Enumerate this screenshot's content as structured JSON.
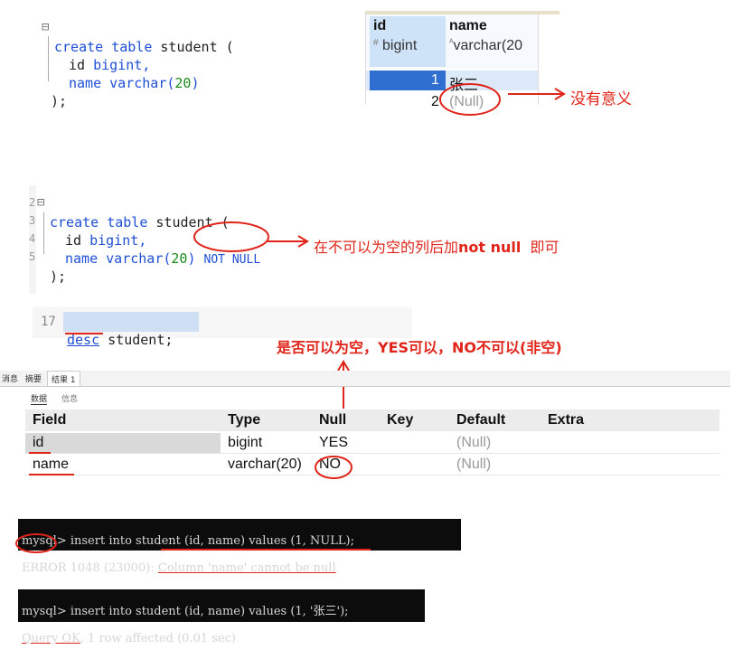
{
  "code1": {
    "line1_kw": "create table",
    "line1_rest": " student (",
    "line2_col": "id",
    "line2_type": "bigint,",
    "line3_col": "name",
    "line3_type": "varchar(",
    "line3_num": "20",
    "line3_end": ")",
    "line4": ");"
  },
  "grid1": {
    "col_id": "id",
    "col_id_type": "bigint",
    "col_name": "name",
    "col_name_type": "varchar(20",
    "row1_id": "1",
    "row1_name": "张三",
    "row2_id": "2",
    "row2_name": "(Null)",
    "annotation": "没有意义"
  },
  "code2": {
    "gutter1": "2",
    "gutter2": "3",
    "gutter3": "4",
    "gutter4": "5",
    "line1_kw": "create table",
    "line1_rest": " student (",
    "line2_col": "id",
    "line2_type": "bigint,",
    "line3_col": "name",
    "line3_type": "varchar(",
    "line3_num": "20",
    "line3_end": ")",
    "line3_notnull": "NOT NULL",
    "line4": ");",
    "annotation_pre": "在不可以为空的列后加",
    "annotation_bold": "not null",
    "annotation_post": "  即可"
  },
  "desc_line": {
    "line_no": "17",
    "kw": "desc",
    "rest": " student;"
  },
  "null_note": "是否可以为空，YES可以，NO不可以(非空)",
  "result_panel": {
    "tabs": [
      "消息",
      "摘要",
      "结果 1"
    ],
    "subtabs": [
      "数据",
      "信息"
    ],
    "headers": [
      "Field",
      "Type",
      "Null",
      "Key",
      "Default",
      "Extra"
    ],
    "rows": [
      {
        "field": "id",
        "type": "bigint",
        "null": "YES",
        "key": "",
        "default": "(Null)",
        "extra": ""
      },
      {
        "field": "name",
        "type": "varchar(20)",
        "null": "NO",
        "key": "",
        "default": "(Null)",
        "extra": ""
      }
    ]
  },
  "terminal1": {
    "line1": "mysql> insert into student (id, name) values (1, NULL);",
    "line2_a": "ERROR",
    "line2_b": " 1048 (23000): ",
    "line2_c": "Column 'name' cannot be null"
  },
  "terminal2": {
    "line1": "mysql> insert into student (id, name) values (1, '张三');",
    "line2_a": "Query OK",
    "line2_b": ", 1 row affected (0.01 sec)"
  },
  "colors": {
    "keyword": "#1e4fd6",
    "number": "#1a8a1a",
    "annotation_red": "#e0241a",
    "selected_row": "#2f6fd0",
    "header_blue": "#cfe3f8"
  }
}
